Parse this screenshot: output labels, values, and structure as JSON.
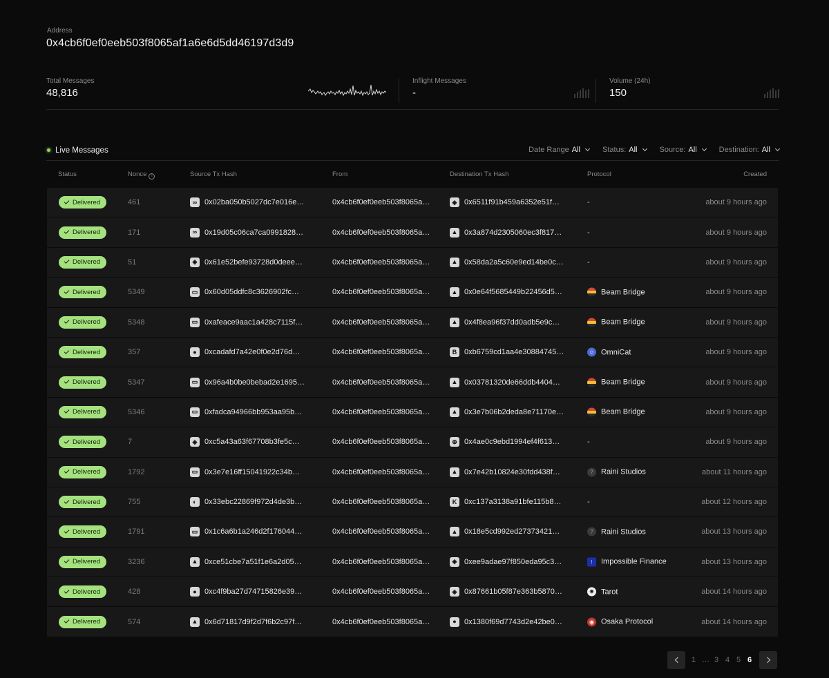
{
  "address": {
    "label": "Address",
    "value": "0x4cb6f0ef0eeb503f8065af1a6e6d5dd46197d3d9"
  },
  "stats": {
    "total": {
      "label": "Total Messages",
      "value": "48,816"
    },
    "inflight": {
      "label": "Inflight Messages",
      "value": "-"
    },
    "volume": {
      "label": "Volume (24h)",
      "value": "150"
    }
  },
  "live": {
    "title": "Live Messages",
    "status_color": "#8fd46a"
  },
  "filters": [
    {
      "label": "Date Range",
      "value": "All"
    },
    {
      "label": "Status:",
      "value": "All"
    },
    {
      "label": "Source:",
      "value": "All"
    },
    {
      "label": "Destination:",
      "value": "All"
    }
  ],
  "columns": {
    "status": "Status",
    "nonce": "Nonce",
    "source": "Source Tx Hash",
    "from": "From",
    "destination": "Destination Tx Hash",
    "protocol": "Protocol",
    "created": "Created"
  },
  "rows": [
    {
      "status": "Delivered",
      "nonce": "461",
      "src_icon": "chain-link-icon",
      "src_glyph": "∞",
      "src_hash": "0x02ba050b5027dc7e016e…",
      "from": "0x4cb6f0ef0eeb503f8065a…",
      "dst_icon": "bnb-chain-icon",
      "dst_glyph": "◈",
      "dst_hash": "0x6511f91b459a6352e51f…",
      "protocol": "-",
      "protocol_icon": "",
      "created": "about 9 hours ago"
    },
    {
      "status": "Delivered",
      "nonce": "171",
      "src_icon": "chain-link-icon",
      "src_glyph": "∞",
      "src_hash": "0x19d05c06ca7ca0991828…",
      "from": "0x4cb6f0ef0eeb503f8065a…",
      "dst_icon": "avalanche-chain-icon",
      "dst_glyph": "▲",
      "dst_hash": "0x3a874d2305060ec3f817…",
      "protocol": "-",
      "protocol_icon": "",
      "created": "about 9 hours ago"
    },
    {
      "status": "Delivered",
      "nonce": "51",
      "src_icon": "bnb-chain-icon",
      "src_glyph": "◈",
      "src_hash": "0x61e52befe93728d0deee…",
      "from": "0x4cb6f0ef0eeb503f8065a…",
      "dst_icon": "avalanche-chain-icon",
      "dst_glyph": "▲",
      "dst_hash": "0x58da2a5c60e9ed14be0c…",
      "protocol": "-",
      "protocol_icon": "",
      "created": "about 9 hours ago"
    },
    {
      "status": "Delivered",
      "nonce": "5349",
      "src_icon": "wallet-chain-icon",
      "src_glyph": "▭",
      "src_hash": "0x60d05ddfc8c3626902fc…",
      "from": "0x4cb6f0ef0eeb503f8065a…",
      "dst_icon": "arbitrum-chain-icon",
      "dst_glyph": "▲",
      "dst_hash": "0x0e64f5685449b22456d5…",
      "protocol": "Beam Bridge",
      "protocol_icon": "beam-bridge-icon",
      "created": "about 9 hours ago"
    },
    {
      "status": "Delivered",
      "nonce": "5348",
      "src_icon": "wallet-chain-icon",
      "src_glyph": "▭",
      "src_hash": "0xafeace9aac1a428c7115f…",
      "from": "0x4cb6f0ef0eeb503f8065a…",
      "dst_icon": "arbitrum-chain-icon",
      "dst_glyph": "▲",
      "dst_hash": "0x4f8ea96f37dd0adb5e9c…",
      "protocol": "Beam Bridge",
      "protocol_icon": "beam-bridge-icon",
      "created": "about 9 hours ago"
    },
    {
      "status": "Delivered",
      "nonce": "357",
      "src_icon": "circle-chain-icon",
      "src_glyph": "●",
      "src_hash": "0xcadafd7a42e0f0e2d76d…",
      "from": "0x4cb6f0ef0eeb503f8065a…",
      "dst_icon": "boba-chain-icon",
      "dst_glyph": "B",
      "dst_hash": "0xb6759cd1aa4e30884745…",
      "protocol": "OmniCat",
      "protocol_icon": "omnicat-icon",
      "created": "about 9 hours ago"
    },
    {
      "status": "Delivered",
      "nonce": "5347",
      "src_icon": "wallet-chain-icon",
      "src_glyph": "▭",
      "src_hash": "0x96a4b0be0bebad2e1695…",
      "from": "0x4cb6f0ef0eeb503f8065a…",
      "dst_icon": "arbitrum-chain-icon",
      "dst_glyph": "▲",
      "dst_hash": "0x03781320de66ddb4404…",
      "protocol": "Beam Bridge",
      "protocol_icon": "beam-bridge-icon",
      "created": "about 9 hours ago"
    },
    {
      "status": "Delivered",
      "nonce": "5346",
      "src_icon": "wallet-chain-icon",
      "src_glyph": "▭",
      "src_hash": "0xfadca94966bb953aa95b…",
      "from": "0x4cb6f0ef0eeb503f8065a…",
      "dst_icon": "arbitrum-chain-icon",
      "dst_glyph": "▲",
      "dst_hash": "0x3e7b06b2deda8e71170e…",
      "protocol": "Beam Bridge",
      "protocol_icon": "beam-bridge-icon",
      "created": "about 9 hours ago"
    },
    {
      "status": "Delivered",
      "nonce": "7",
      "src_icon": "bnb-chain-icon",
      "src_glyph": "◈",
      "src_hash": "0xc5a43a63f67708b3fe5c…",
      "from": "0x4cb6f0ef0eeb503f8065a…",
      "dst_icon": "globe-chain-icon",
      "dst_glyph": "⊕",
      "dst_hash": "0x4ae0c9ebd1994ef4f613…",
      "protocol": "-",
      "protocol_icon": "",
      "created": "about 9 hours ago"
    },
    {
      "status": "Delivered",
      "nonce": "1792",
      "src_icon": "wallet-chain-icon",
      "src_glyph": "▭",
      "src_hash": "0x3e7e16ff15041922c34b…",
      "from": "0x4cb6f0ef0eeb503f8065a…",
      "dst_icon": "arbitrum-chain-icon",
      "dst_glyph": "▲",
      "dst_hash": "0x7e42b10824e30fdd438f…",
      "protocol": "Raini Studios",
      "protocol_icon": "unknown-protocol-icon",
      "created": "about 11 hours ago"
    },
    {
      "status": "Delivered",
      "nonce": "755",
      "src_icon": "celo-chain-icon",
      "src_glyph": "◐",
      "src_hash": "0x33ebc22869f972d4de3b…",
      "from": "0x4cb6f0ef0eeb503f8065a…",
      "dst_icon": "kava-chain-icon",
      "dst_glyph": "K",
      "dst_hash": "0xc137a3138a91bfe115b8…",
      "protocol": "-",
      "protocol_icon": "",
      "created": "about 12 hours ago"
    },
    {
      "status": "Delivered",
      "nonce": "1791",
      "src_icon": "wallet-chain-icon",
      "src_glyph": "▭",
      "src_hash": "0x1c6a6b1a246d2f176044…",
      "from": "0x4cb6f0ef0eeb503f8065a…",
      "dst_icon": "arbitrum-chain-icon",
      "dst_glyph": "▲",
      "dst_hash": "0x18e5cd992ed27373421…",
      "protocol": "Raini Studios",
      "protocol_icon": "unknown-protocol-icon",
      "created": "about 13 hours ago"
    },
    {
      "status": "Delivered",
      "nonce": "3236",
      "src_icon": "avalanche-chain-icon",
      "src_glyph": "▲",
      "src_hash": "0xce51cbe7a51f1e6a2d05…",
      "from": "0x4cb6f0ef0eeb503f8065a…",
      "dst_icon": "bnb-chain-icon",
      "dst_glyph": "◈",
      "dst_hash": "0xee9adae97f850eda95c3…",
      "protocol": "Impossible Finance",
      "protocol_icon": "impossible-finance-icon",
      "created": "about 13 hours ago"
    },
    {
      "status": "Delivered",
      "nonce": "428",
      "src_icon": "circle-chain-icon",
      "src_glyph": "●",
      "src_hash": "0xc4f9ba27d74715826e39…",
      "from": "0x4cb6f0ef0eeb503f8065a…",
      "dst_icon": "bnb-chain-icon",
      "dst_glyph": "◈",
      "dst_hash": "0x87661b05f87e363b5870…",
      "protocol": "Tarot",
      "protocol_icon": "tarot-icon",
      "created": "about 14 hours ago"
    },
    {
      "status": "Delivered",
      "nonce": "574",
      "src_icon": "arbitrum-chain-icon",
      "src_glyph": "▲",
      "src_hash": "0x6d71817d9f2d7f6b2c97f…",
      "from": "0x4cb6f0ef0eeb503f8065a…",
      "dst_icon": "circle-chain-icon",
      "dst_glyph": "●",
      "dst_hash": "0x1380f69d7743d2e42be0…",
      "protocol": "Osaka Protocol",
      "protocol_icon": "osaka-protocol-icon",
      "created": "about 14 hours ago"
    }
  ],
  "pagination": {
    "pages": [
      "1",
      "…",
      "3",
      "4",
      "5",
      "6"
    ],
    "current": "6"
  },
  "colors": {
    "delivered_badge": "#a5e27f",
    "background": "#0b0b0b",
    "row": "#181818"
  }
}
